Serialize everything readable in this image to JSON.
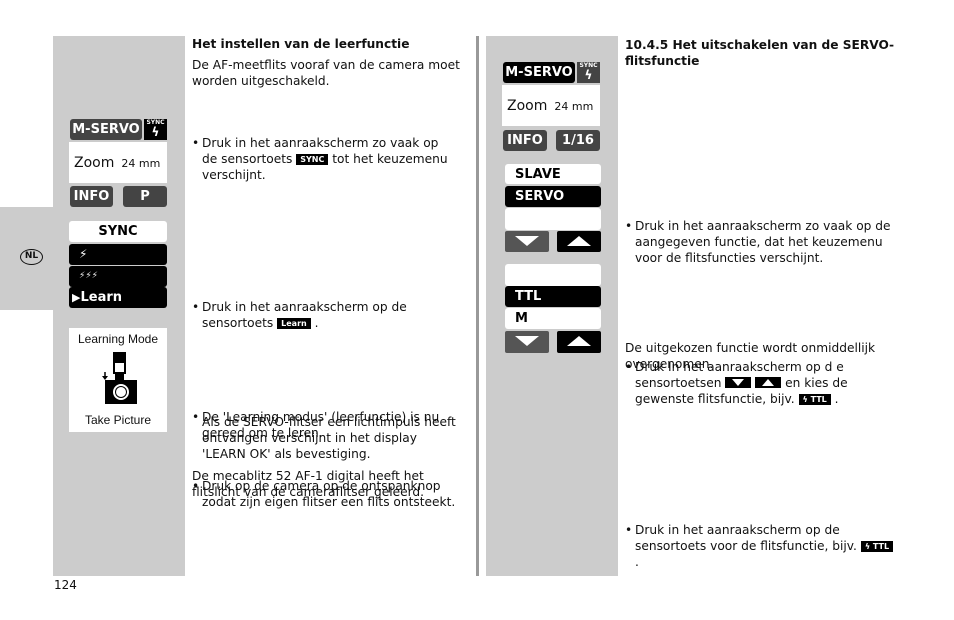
{
  "language_tab": "NL",
  "page_number": "124",
  "left": {
    "heading": "Het instellen van de leerfunctie",
    "intro": "De AF-meetflits vooraf van de camera moet worden uitgeschakeld.",
    "step1_a": "Druk in het aanraakscherm zo vaak op de sensortoets",
    "step1_key": "SYNC",
    "step1_b": "tot het keuzemenu verschijnt.",
    "step2_a": "Druk in het aanraakscherm op de sensortoets",
    "step2_key": "Learn",
    "step2_b": ".",
    "step3": "De 'Learning modus' (leerfunctie) is nu gereed om te leren.",
    "step4": "Druk op de camera op de ontspanknop zodat zijn eigen flitser een flits ontsteekt.",
    "step4_note": "Als de SERVO-flitser een lichtimpuls heeft ontvangen verschijnt in het display 'LEARN OK' als bevestiging.",
    "outro": "De mecablitz 52 AF-1 digital heeft het flitslicht van de cameraflitser geleerd."
  },
  "right": {
    "heading_num": "10.4.5",
    "heading": "Het uitschakelen van de SERVO-flitsfunctie",
    "step1": "Druk in het aanraakscherm zo vaak op de aangegeven functie, dat het keuzemenu voor de flitsfuncties verschijnt.",
    "step2_a": "Druk In het aanraakscherm op d e sensortoetsen",
    "step2_b": "en kies de gewenste flitsfunctie, bijv.",
    "step2_key": "TTL",
    "step3_a": "Druk in het aanraakscherm op de  sensortoets voor de flitsfunctie, bijv.",
    "step3_key": "TTL",
    "outro": "De uitgekozen functie wordt onmiddellijk overgenomen."
  },
  "lcd_left_main": {
    "mode": "M-SERVO",
    "sync_label": "SYNC",
    "zoom_label": "Zoom",
    "zoom_value": "24 mm",
    "info": "INFO",
    "program": "P"
  },
  "lcd_sync_menu": {
    "title": "SYNC",
    "items": [
      "⚡",
      "⚡⚡⚡",
      "Learn"
    ]
  },
  "lcd_learning": {
    "title": "Learning Mode",
    "action": "Take Picture"
  },
  "lcd_right_main": {
    "mode": "M-SERVO",
    "sync_label": "SYNC",
    "zoom_label": "Zoom",
    "zoom_value": "24 mm",
    "info": "INFO",
    "power": "1/16"
  },
  "lcd_mode_menu": {
    "items": [
      "SLAVE",
      "SERVO",
      ""
    ]
  },
  "lcd_func_menu": {
    "items": [
      "",
      "TTL",
      "M"
    ]
  }
}
